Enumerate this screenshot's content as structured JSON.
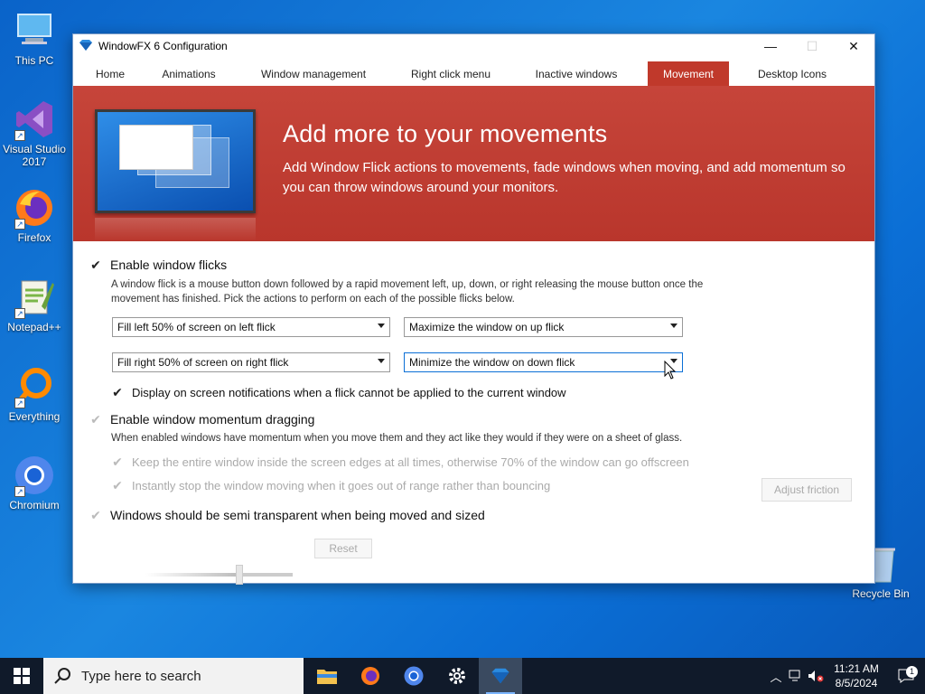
{
  "desktop": {
    "icons": [
      {
        "label": "This PC",
        "icon": "computer-icon"
      },
      {
        "label": "Visual Studio 2017",
        "icon": "visual-studio-icon"
      },
      {
        "label": "Firefox",
        "icon": "firefox-icon"
      },
      {
        "label": "Notepad++",
        "icon": "notepad-plus-plus-icon"
      },
      {
        "label": "Everything",
        "icon": "everything-search-icon"
      },
      {
        "label": "Chromium",
        "icon": "chromium-icon"
      },
      {
        "label": "Recycle Bin",
        "icon": "recycle-bin-icon"
      }
    ]
  },
  "window": {
    "title": "WindowFX 6 Configuration",
    "controls": {
      "minimize": "—",
      "maximize": "☐",
      "close": "✕"
    },
    "tabs": [
      {
        "label": "Home",
        "active": false
      },
      {
        "label": "Animations",
        "active": false
      },
      {
        "label": "Window management",
        "active": false
      },
      {
        "label": "Right click menu",
        "active": false
      },
      {
        "label": "Inactive windows",
        "active": false
      },
      {
        "label": "Movement",
        "active": true
      },
      {
        "label": "Desktop Icons",
        "active": false
      }
    ],
    "banner": {
      "heading": "Add more to your movements",
      "text": "Add Window Flick actions to movements, fade windows when moving, and add momentum so you can throw windows around your monitors."
    },
    "flicks": {
      "enable_label": "Enable window flicks",
      "enabled": true,
      "description": "A window flick is a mouse button down followed by a rapid movement left, up, down, or right releasing the mouse button once the movement has finished.  Pick the actions to perform on each of the possible flicks below.",
      "left_flick": "Fill left 50% of screen on left flick",
      "up_flick": "Maximize the window on up flick",
      "right_flick": "Fill right 50% of screen on right flick",
      "down_flick": "Minimize the window on down flick",
      "notify_label": "Display on screen notifications when a flick cannot be applied to the current window",
      "notify_enabled": true
    },
    "momentum": {
      "enable_label": "Enable window momentum dragging",
      "description": "When enabled windows have momentum when you move them and they act like they would if they were on a sheet of glass.",
      "keep_inside_label": "Keep the entire window inside the screen edges at all times, otherwise 70% of the window can go offscreen",
      "instant_stop_label": "Instantly stop the window moving when it goes out of range rather than bouncing",
      "adjust_friction_label": "Adjust friction"
    },
    "transparency": {
      "label": "Windows should be semi transparent when being moved and sized",
      "reset_label": "Reset",
      "slider_value": 0.64
    }
  },
  "taskbar": {
    "search_placeholder": "Type here to search",
    "apps": [
      "file-explorer-icon",
      "firefox-icon",
      "chromium-icon",
      "settings-gear-icon",
      "windowfx-icon"
    ],
    "time": "11:21 AM",
    "date": "8/5/2024",
    "notification_count": "1"
  },
  "colors": {
    "accent_red": "#c0392b",
    "desktop_blue": "#0b6fd6",
    "taskbar": "#101a2a"
  }
}
